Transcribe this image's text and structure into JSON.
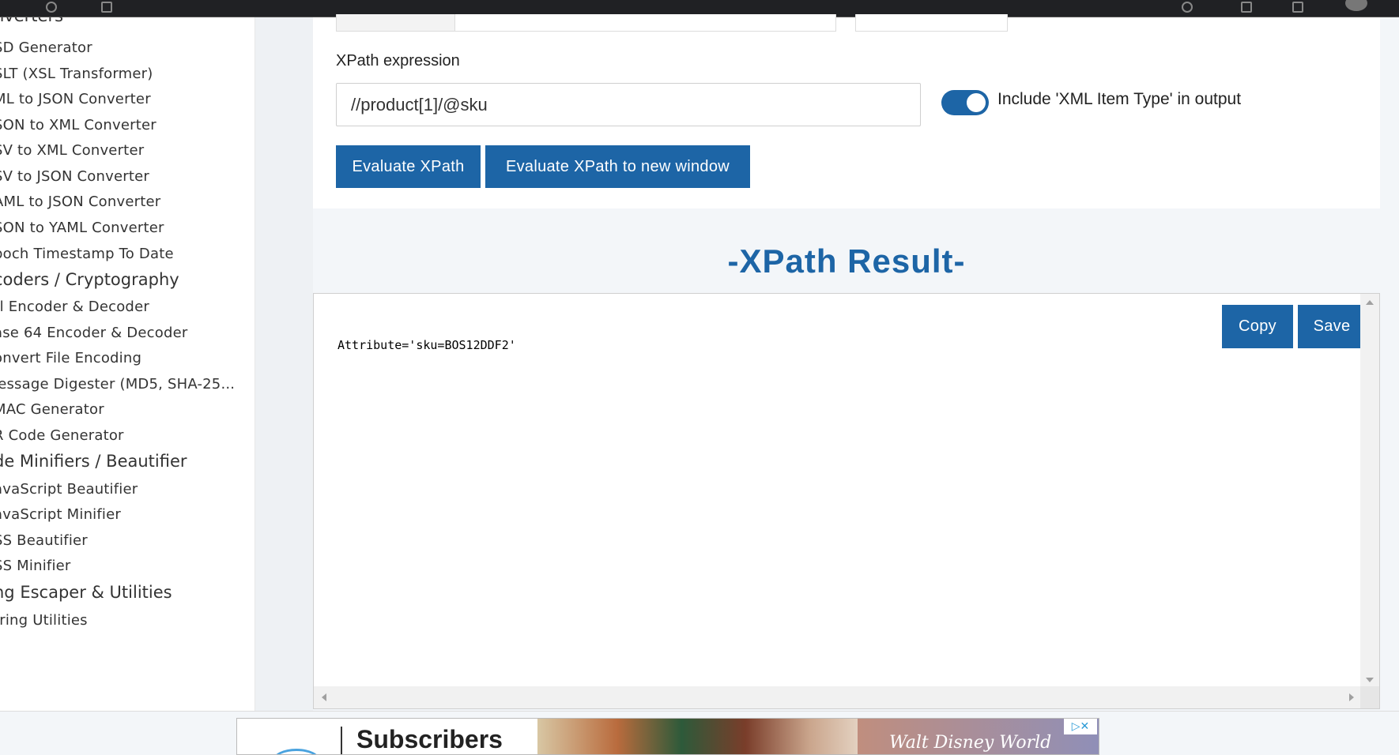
{
  "sidebar": {
    "top_partial": "nverters",
    "items": [
      {
        "label": "SD Generator",
        "type": "item"
      },
      {
        "label": "SLT (XSL Transformer)",
        "type": "item"
      },
      {
        "label": "ML to JSON Converter",
        "type": "item"
      },
      {
        "label": "SON to XML Converter",
        "type": "item"
      },
      {
        "label": "SV to XML Converter",
        "type": "item"
      },
      {
        "label": "SV to JSON Converter",
        "type": "item"
      },
      {
        "label": "AML to JSON Converter",
        "type": "item"
      },
      {
        "label": "SON to YAML Converter",
        "type": "item"
      },
      {
        "label": "poch Timestamp To Date",
        "type": "item"
      },
      {
        "label": "coders / Cryptography",
        "type": "category"
      },
      {
        "label": "rl Encoder & Decoder",
        "type": "item"
      },
      {
        "label": "ase 64 Encoder & Decoder",
        "type": "item"
      },
      {
        "label": "onvert File Encoding",
        "type": "item"
      },
      {
        "label": "lessage Digester (MD5, SHA-25...",
        "type": "item"
      },
      {
        "label": "MAC Generator",
        "type": "item"
      },
      {
        "label": "R Code Generator",
        "type": "item"
      },
      {
        "label": "de Minifiers / Beautifier",
        "type": "category"
      },
      {
        "label": "avaScript Beautifier",
        "type": "item"
      },
      {
        "label": "avaScript Minifier",
        "type": "item"
      },
      {
        "label": "SS Beautifier",
        "type": "item"
      },
      {
        "label": "SS Minifier",
        "type": "item"
      },
      {
        "label": "ng Escaper & Utilities",
        "type": "category"
      },
      {
        "label": "tring Utilities",
        "type": "item"
      }
    ]
  },
  "form": {
    "xpath_label": "XPath expression",
    "xpath_value": "//product[1]/@sku",
    "toggle_label": "Include 'XML Item Type' in output",
    "toggle_on": true,
    "evaluate_label": "Evaluate XPath",
    "evaluate_new_label": "Evaluate XPath to new window"
  },
  "result": {
    "title": "-XPath Result-",
    "text": "Attribute='sku=BOS12DDF2'",
    "copy_label": "Copy",
    "save_label": "Save"
  },
  "ad": {
    "headline": "Subscribers",
    "brand": "Walt Disney World",
    "adchoice": "▷✕"
  },
  "colors": {
    "accent": "#1d65a6"
  }
}
